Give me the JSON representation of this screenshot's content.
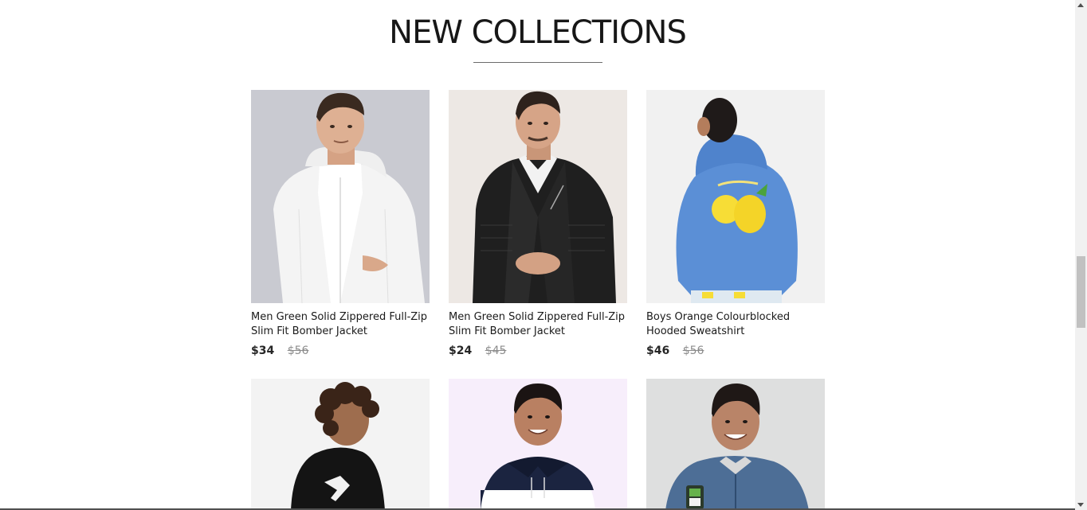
{
  "section": {
    "title": "NEW COLLECTIONS"
  },
  "products": [
    {
      "title": "Men Green Solid Zippered Full-Zip Slim Fit Bomber Jacket",
      "price": "$34",
      "old_price": "$56",
      "image": "white-jacket-man",
      "bg_color": "#c9cad1"
    },
    {
      "title": "Men Green Solid Zippered Full-Zip Slim Fit Bomber Jacket",
      "price": "$24",
      "old_price": "$45",
      "image": "black-leather-jacket-man",
      "bg_color": "#ede8e4"
    },
    {
      "title": "Boys Orange Colourblocked Hooded Sweatshirt",
      "price": "$46",
      "old_price": "$56",
      "image": "blue-hoodie-boy",
      "bg_color": "#f1f1f1"
    },
    {
      "image": "black-hoodie-boy",
      "bg_color": "#f3f3f3"
    },
    {
      "image": "navy-white-hoodie-boy",
      "bg_color": "#f7eefb"
    },
    {
      "image": "denim-jacket-boy",
      "bg_color": "#dedfdf"
    }
  ]
}
